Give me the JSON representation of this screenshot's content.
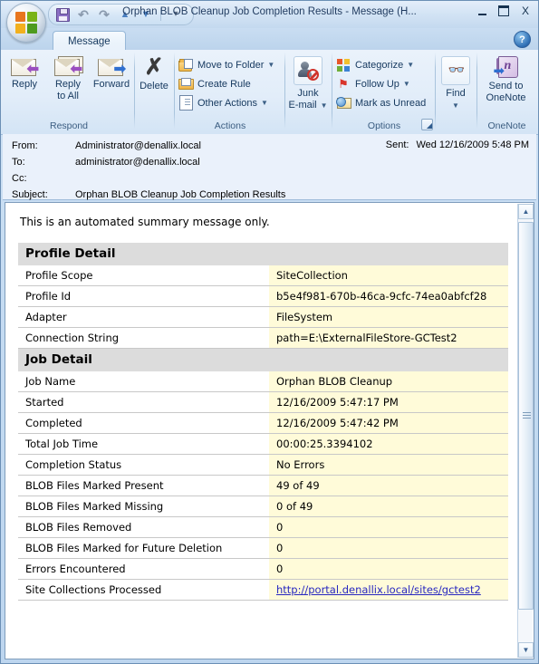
{
  "window": {
    "title": "Orphan BLOB Cleanup Job Completion Results - Message (H...",
    "minimize_label": "Minimize",
    "maximize_label": "Maximize",
    "close_label": "X",
    "help_label": "?"
  },
  "quick_access": {
    "save_label": "Save",
    "undo_label": "Undo",
    "redo_label": "Redo",
    "previous_label": "Previous Item",
    "next_label": "Next Item",
    "customize_label": "Customize Quick Access Toolbar"
  },
  "ribbon": {
    "tab_label": "Message",
    "groups": [
      {
        "name": "Respond",
        "label": "Respond",
        "buttons": [
          {
            "label": "Reply",
            "icon": "reply-envelope-icon"
          },
          {
            "label": "Reply\nto All",
            "line1": "Reply",
            "line2": "to All",
            "icon": "reply-all-envelope-icon"
          },
          {
            "label": "Forward",
            "icon": "forward-envelope-icon"
          }
        ]
      },
      {
        "name": "Delete",
        "label": "",
        "buttons": [
          {
            "label": "Delete",
            "icon": "delete-x-icon"
          }
        ]
      },
      {
        "name": "Actions",
        "label": "Actions",
        "items": [
          {
            "label": "Move to Folder",
            "icon": "move-to-folder-icon",
            "has_caret": true
          },
          {
            "label": "Create Rule",
            "icon": "create-rule-icon",
            "has_caret": false
          },
          {
            "label": "Other Actions",
            "icon": "other-actions-icon",
            "has_caret": true
          }
        ]
      },
      {
        "name": "Junk",
        "label": "",
        "buttons": [
          {
            "line1": "Junk",
            "line2": "E-mail",
            "icon": "junk-email-icon",
            "has_caret": true
          }
        ]
      },
      {
        "name": "Options",
        "label": "Options",
        "items": [
          {
            "label": "Categorize",
            "icon": "categorize-icon",
            "has_caret": true
          },
          {
            "label": "Follow Up",
            "icon": "follow-up-flag-icon",
            "has_caret": true
          },
          {
            "label": "Mark as Unread",
            "icon": "mark-as-unread-icon",
            "has_caret": false
          }
        ],
        "dialog_launcher": true
      },
      {
        "name": "Find",
        "label": "",
        "buttons": [
          {
            "label": "Find",
            "icon": "find-binoculars-icon",
            "has_caret": true
          }
        ]
      },
      {
        "name": "OneNote",
        "label": "OneNote",
        "buttons": [
          {
            "line1": "Send to",
            "line2": "OneNote",
            "icon": "onenote-icon"
          }
        ]
      }
    ]
  },
  "message_header": {
    "from_label": "From:",
    "from_value": "Administrator@denallix.local",
    "to_label": "To:",
    "to_value": "administrator@denallix.local",
    "cc_label": "Cc:",
    "cc_value": "",
    "subject_label": "Subject:",
    "subject_value": "Orphan BLOB Cleanup Job Completion Results",
    "sent_label": "Sent:",
    "sent_value": "Wed 12/16/2009 5:48 PM"
  },
  "body": {
    "intro": "This is an automated summary message only.",
    "sections": [
      {
        "title": "Profile Detail",
        "rows": [
          {
            "key": "Profile Scope",
            "value": "SiteCollection",
            "is_link": false
          },
          {
            "key": "Profile Id",
            "value": "b5e4f981-670b-46ca-9cfc-74ea0abfcf28",
            "is_link": false
          },
          {
            "key": "Adapter",
            "value": "FileSystem",
            "is_link": false
          },
          {
            "key": "Connection String",
            "value": "path=E:\\ExternalFileStore-GCTest2",
            "is_link": false
          }
        ]
      },
      {
        "title": "Job Detail",
        "rows": [
          {
            "key": "Job Name",
            "value": "Orphan BLOB Cleanup",
            "is_link": false
          },
          {
            "key": "Started",
            "value": "12/16/2009 5:47:17 PM",
            "is_link": false
          },
          {
            "key": "Completed",
            "value": "12/16/2009 5:47:42 PM",
            "is_link": false
          },
          {
            "key": "Total Job Time",
            "value": "00:00:25.3394102",
            "is_link": false
          },
          {
            "key": "Completion Status",
            "value": "No Errors",
            "is_link": false
          },
          {
            "key": "BLOB Files Marked Present",
            "value": "49 of 49",
            "is_link": false
          },
          {
            "key": "BLOB Files Marked Missing",
            "value": "0 of 49",
            "is_link": false
          },
          {
            "key": "BLOB Files Removed",
            "value": "0",
            "is_link": false
          },
          {
            "key": "BLOB Files Marked for Future Deletion",
            "value": "0",
            "is_link": false
          },
          {
            "key": "Errors Encountered",
            "value": "0",
            "is_link": false
          },
          {
            "key": "Site Collections Processed",
            "value": "http://portal.denallix.local/sites/gctest2",
            "is_link": true
          }
        ]
      }
    ]
  },
  "scrollbar": {
    "up_label": "▲",
    "down_label": "▼"
  },
  "colors": {
    "value_cell_bg": "#fffbd9",
    "section_header_bg": "#dcdcdc",
    "link": "#2727c0",
    "ribbon_bg": "#e2edf9",
    "header_bg": "#eaf1fb"
  }
}
